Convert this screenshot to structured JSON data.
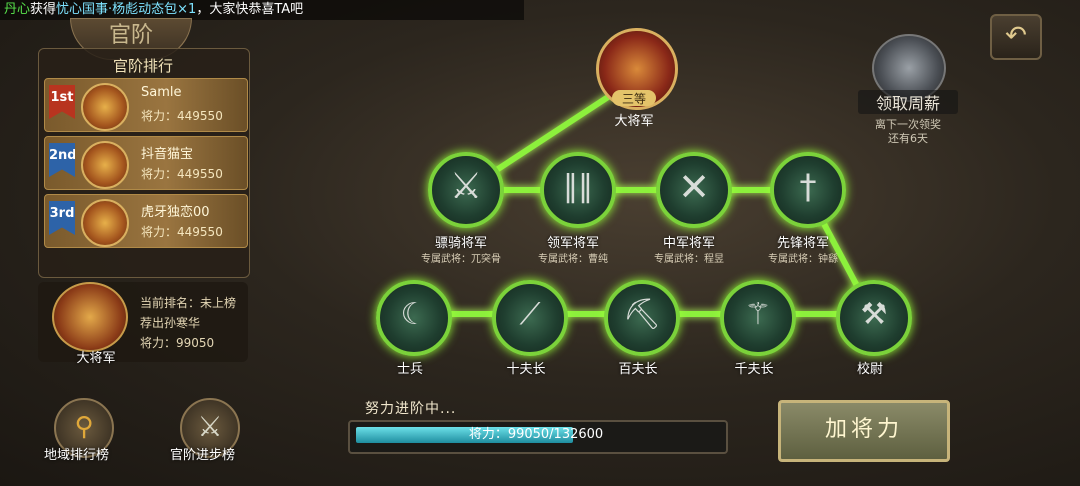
{
  "marquee": {
    "prefix": "丹心",
    "verb": "获得",
    "item": "忧心国事·杨彪动态包×1",
    "suffix": "，大家快恭喜TA吧"
  },
  "left": {
    "header_title": "官阶",
    "ranking_title": "官阶排行",
    "rankings": [
      {
        "badge": "1st",
        "name": "Samle",
        "power_label": "将力：",
        "power": "449550"
      },
      {
        "badge": "2nd",
        "name": "抖音猫宝",
        "power_label": "将力：",
        "power": "449550"
      },
      {
        "badge": "3rd",
        "name": "虎牙独恋00",
        "power_label": "将力：",
        "power": "449550"
      }
    ],
    "self": {
      "rank_text": "当前排名：未上榜",
      "name": "荐出孙寒华",
      "power_text": "将力：99050",
      "emblem_label": "大将军"
    }
  },
  "bottom_buttons": {
    "region_rank": "地域排行榜",
    "rank_progress": "官阶进步榜"
  },
  "top_right": {
    "back_glyph": "↶",
    "chest_label": "领取周薪",
    "chest_sub1": "离下一次领奖",
    "chest_sub2": "还有6天"
  },
  "tree": {
    "top": {
      "rank": "三等",
      "label": "大将军"
    },
    "row2": [
      {
        "label": "骠骑将军",
        "general": "专属武将：兀突骨"
      },
      {
        "label": "领军将军",
        "general": "专属武将：曹纯"
      },
      {
        "label": "中军将军",
        "general": "专属武将：程昱"
      },
      {
        "label": "先锋将军",
        "general": "专属武将：钟繇"
      }
    ],
    "row3": [
      {
        "label": "士兵"
      },
      {
        "label": "十夫长"
      },
      {
        "label": "百夫长"
      },
      {
        "label": "千夫长"
      },
      {
        "label": "校尉"
      }
    ]
  },
  "progress": {
    "status": "努力进阶中...",
    "bar_text": "将力：99050/132600",
    "current": 99050,
    "max": 132600,
    "button": "加将力"
  },
  "colors": {
    "link": "#8cf03c",
    "accent_gold": "#d9b060"
  }
}
